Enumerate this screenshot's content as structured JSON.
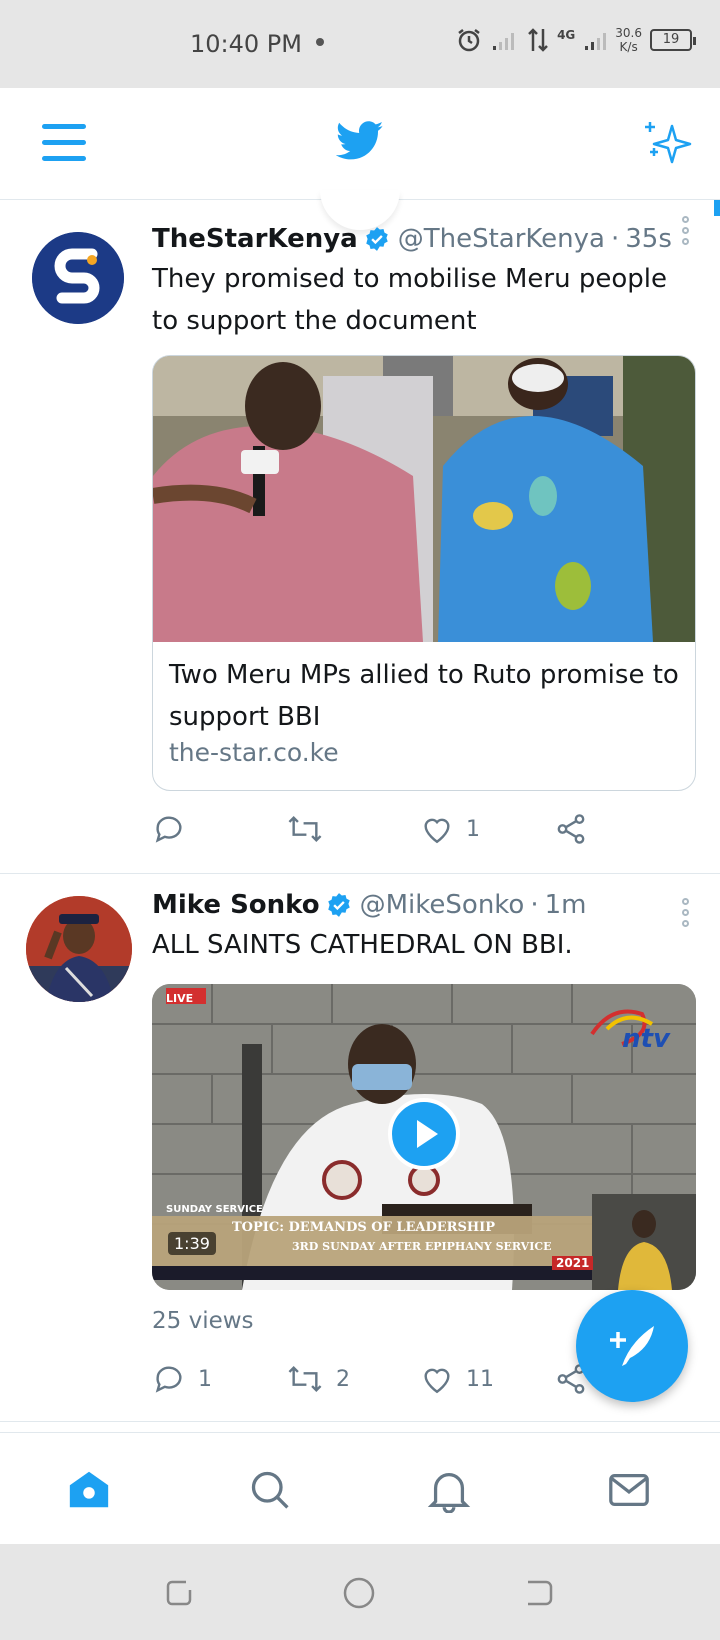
{
  "status_bar": {
    "time": "10:40 PM",
    "network": "4G",
    "speed_value": "30.6",
    "speed_unit": "K/s",
    "battery": "19"
  },
  "tweets": [
    {
      "name": "TheStarKenya",
      "handle": "@TheStarKenya",
      "separator": "·",
      "time": "35s",
      "text": "They promised to mobilise Meru people to support the document",
      "card": {
        "title": "Two Meru MPs allied to Ruto promise to support BBI",
        "domain": "the-star.co.ke"
      },
      "actions": {
        "reply": "",
        "retweet": "",
        "like": "1"
      }
    },
    {
      "name": "Mike Sonko",
      "handle": "@MikeSonko",
      "separator": "·",
      "time": "1m",
      "text": "ALL SAINTS CATHEDRAL ON BBI.",
      "video": {
        "duration": "1:39",
        "live_tag": "LIVE",
        "channel": "ntv",
        "topic": "TOPIC: DEMANDS OF LEADERSHIP",
        "service": "SUNDAY SERVICE",
        "sub": "3RD SUNDAY AFTER EPIPHANY SERVICE",
        "year": "2021"
      },
      "views": "25 views",
      "actions": {
        "reply": "1",
        "retweet": "2",
        "like": "11"
      }
    }
  ],
  "colors": {
    "accent": "#1da1f2",
    "secondary_text": "#657786",
    "divider": "#e1e8ed"
  },
  "icons": [
    "menu-icon",
    "twitter-bird-icon",
    "sparkle-icon",
    "verified-icon",
    "more-icon",
    "reply-icon",
    "retweet-icon",
    "like-icon",
    "share-icon",
    "play-icon",
    "compose-icon",
    "home-icon",
    "search-icon",
    "bell-icon",
    "mail-icon"
  ]
}
